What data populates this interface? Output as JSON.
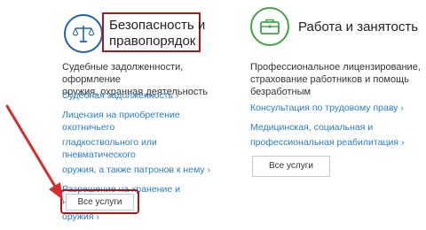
{
  "colors": {
    "security_accent": "#1f63a8",
    "work_accent": "#3fa646",
    "link": "#2a7cc3",
    "highlight": "#a8191b"
  },
  "security": {
    "icon": "scales-icon",
    "title_line1": "Безопасность и",
    "title_line2": "правопорядок",
    "desc_line1": "Судебные задолженности, оформление",
    "desc_line2": "оружия, охранная деятельность",
    "links": [
      [
        "Судебная задолженность ›"
      ],
      [
        "Лицензия на приобретение охотничьего",
        "гладкоствольного или пневматического",
        "оружия, а также патронов к нему ›"
      ],
      [
        "Разрешение на хранение и ношение",
        "оружия ›"
      ]
    ],
    "button": "Все услуги"
  },
  "work": {
    "icon": "briefcase-icon",
    "title": "Работа и занятость",
    "desc_line1": "Профессиональное лицензирование,",
    "desc_line2": "страхование работников и помощь",
    "desc_line3": "безработным",
    "links": [
      [
        "Консультация по трудовому праву ›"
      ],
      [
        "Медицинская, социальная и",
        "профессиональная реабилитация ›"
      ]
    ],
    "button": "Все услуги"
  }
}
